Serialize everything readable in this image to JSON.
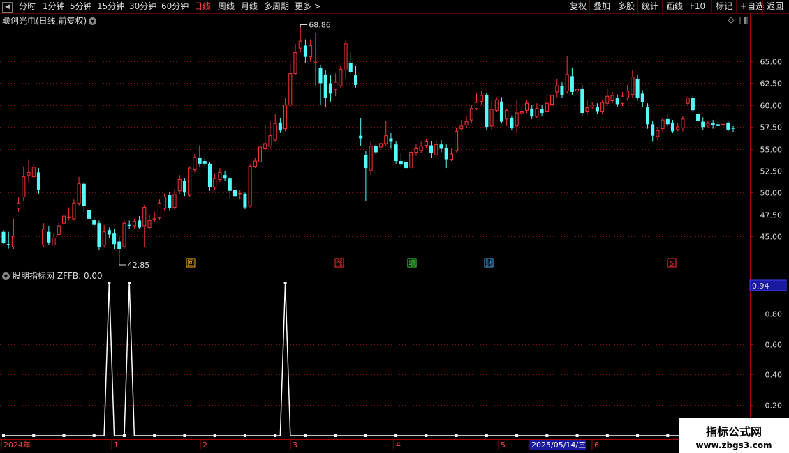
{
  "toolbar": {
    "periods": [
      "分时",
      "1分钟",
      "5分钟",
      "15分钟",
      "30分钟",
      "60分钟",
      "日线",
      "周线",
      "月线",
      "多周期",
      "更多 >"
    ],
    "active_period": "日线",
    "right_buttons": [
      "复权",
      "叠加",
      "多股",
      "统计",
      "画线",
      "F10",
      "标记",
      "+自选",
      "返回"
    ]
  },
  "main_panel": {
    "title": "联创光电(日线,前复权)",
    "high_label": "68.86",
    "low_label": "42.85",
    "price_ticks": [
      "65.00",
      "62.50",
      "60.00",
      "57.50",
      "55.00",
      "52.50",
      "50.00",
      "47.50",
      "45.00"
    ],
    "markers": [
      {
        "text": "回",
        "color": "#ffb020"
      },
      {
        "text": "涨",
        "color": "#ff3030"
      },
      {
        "text": "增",
        "color": "#40e040"
      },
      {
        "text": "财",
        "color": "#4ab0ff"
      },
      {
        "text": "$",
        "color": "#ff3030"
      }
    ]
  },
  "sub_panel": {
    "title": "股朋指标网",
    "indicator": "ZFFB: 0.00",
    "current_value": "0.94",
    "ticks": [
      "0.80",
      "0.60",
      "0.40",
      "0.20"
    ]
  },
  "date_axis": {
    "labels": [
      "2024年",
      "1",
      "2",
      "3",
      "4",
      "5",
      "2025/05/14/三",
      "6"
    ]
  },
  "watermark": {
    "title": "指标公式网",
    "url": "www.zbgs3.com"
  },
  "chart_data": {
    "type": "candlestick",
    "price_range": [
      42.0,
      70.0
    ],
    "sub_range": [
      0,
      1.0
    ],
    "high": 68.86,
    "low": 42.85,
    "sub_spikes": [
      {
        "candle_index": 21,
        "value": 1.0
      },
      {
        "candle_index": 25,
        "value": 1.0
      },
      {
        "candle_index": 56,
        "value": 1.0
      }
    ],
    "candles": [
      [
        45.5,
        44.2,
        45.7,
        44.1
      ],
      [
        44.1,
        44.0,
        45.5,
        43.6
      ],
      [
        43.8,
        45.0,
        47.0,
        43.5
      ],
      [
        48.2,
        48.8,
        49.5,
        47.8
      ],
      [
        49.5,
        51.8,
        53.0,
        49.0
      ],
      [
        52.0,
        52.3,
        53.8,
        51.2
      ],
      [
        51.8,
        52.9,
        53.3,
        51.5
      ],
      [
        52.3,
        50.3,
        52.8,
        49.8
      ],
      [
        44.0,
        45.8,
        46.5,
        43.7
      ],
      [
        45.5,
        44.3,
        46.2,
        44.0
      ],
      [
        44.0,
        44.8,
        45.3,
        43.9
      ],
      [
        45.2,
        46.2,
        46.6,
        45.0
      ],
      [
        46.5,
        47.3,
        48.0,
        45.9
      ],
      [
        47.2,
        47.2,
        48.3,
        46.8
      ],
      [
        47.0,
        48.8,
        49.2,
        46.8
      ],
      [
        48.8,
        51.0,
        51.8,
        48.5
      ],
      [
        51.0,
        48.5,
        51.2,
        47.8
      ],
      [
        48.0,
        47.0,
        49.0,
        46.5
      ],
      [
        46.9,
        46.3,
        47.1,
        46.0
      ],
      [
        46.5,
        43.8,
        46.8,
        43.4
      ],
      [
        44.0,
        45.5,
        46.3,
        43.7
      ],
      [
        45.7,
        45.2,
        46.0,
        44.8
      ],
      [
        45.3,
        44.1,
        45.8,
        43.5
      ],
      [
        44.4,
        43.5,
        45.0,
        42.85
      ],
      [
        43.8,
        46.5,
        46.8,
        43.6
      ],
      [
        46.3,
        46.2,
        46.8,
        45.8
      ],
      [
        46.2,
        46.7,
        47.0,
        45.9
      ],
      [
        46.8,
        46.0,
        47.3,
        45.8
      ],
      [
        46.2,
        48.3,
        48.6,
        43.8
      ],
      [
        46.0,
        46.8,
        47.5,
        45.8
      ],
      [
        46.9,
        47.0,
        47.8,
        46.6
      ],
      [
        47.1,
        48.8,
        49.2,
        46.9
      ],
      [
        48.2,
        49.5,
        49.9,
        47.9
      ],
      [
        49.7,
        48.2,
        50.1,
        47.9
      ],
      [
        48.3,
        49.8,
        50.4,
        48.0
      ],
      [
        50.2,
        51.5,
        52.0,
        49.8
      ],
      [
        51.3,
        50.0,
        51.6,
        49.6
      ],
      [
        49.7,
        52.8,
        53.0,
        49.5
      ],
      [
        52.6,
        54.0,
        54.4,
        52.3
      ],
      [
        54.0,
        53.3,
        55.4,
        52.9
      ],
      [
        53.6,
        53.3,
        54.0,
        53.0
      ],
      [
        53.3,
        50.6,
        53.5,
        50.2
      ],
      [
        50.6,
        51.6,
        52.2,
        50.3
      ],
      [
        51.5,
        52.3,
        52.8,
        51.2
      ],
      [
        52.0,
        51.6,
        52.5,
        51.3
      ],
      [
        51.6,
        50.2,
        51.8,
        49.3
      ],
      [
        50.3,
        49.6,
        50.6,
        49.3
      ],
      [
        49.8,
        49.9,
        50.3,
        49.2
      ],
      [
        49.8,
        48.3,
        50.0,
        48.1
      ],
      [
        48.5,
        53.0,
        53.2,
        48.3
      ],
      [
        53.0,
        53.6,
        54.0,
        52.8
      ],
      [
        53.5,
        55.2,
        55.8,
        53.2
      ],
      [
        55.0,
        55.6,
        57.8,
        54.8
      ],
      [
        55.3,
        56.5,
        58.2,
        55.0
      ],
      [
        56.0,
        57.9,
        59.0,
        55.8
      ],
      [
        58.0,
        57.1,
        58.5,
        56.8
      ],
      [
        57.3,
        60.0,
        60.8,
        57.0
      ],
      [
        60.0,
        63.6,
        64.7,
        59.8
      ],
      [
        63.6,
        66.0,
        67.0,
        63.4
      ],
      [
        66.5,
        67.3,
        68.86,
        66.0
      ],
      [
        66.8,
        65.5,
        67.5,
        64.8
      ],
      [
        65.5,
        66.8,
        67.5,
        65.0
      ],
      [
        64.8,
        64.9,
        68.3,
        62.2
      ],
      [
        64.2,
        62.5,
        64.6,
        60.0
      ],
      [
        63.5,
        60.8,
        64.0,
        59.8
      ],
      [
        62.5,
        61.3,
        63.4,
        60.4
      ],
      [
        61.8,
        62.6,
        63.6,
        61.0
      ],
      [
        62.2,
        64.1,
        64.5,
        62.0
      ],
      [
        64.0,
        67.0,
        67.5,
        63.0
      ],
      [
        64.8,
        63.8,
        66.0,
        63.5
      ],
      [
        63.4,
        62.3,
        64.5,
        62.0
      ],
      [
        56.5,
        56.2,
        58.5,
        55.3
      ],
      [
        54.3,
        52.8,
        54.8,
        49.0
      ],
      [
        52.5,
        55.3,
        55.8,
        52.0
      ],
      [
        55.3,
        54.6,
        55.6,
        54.3
      ],
      [
        55.2,
        55.6,
        57.0,
        54.8
      ],
      [
        55.6,
        56.5,
        58.2,
        55.3
      ],
      [
        56.2,
        55.8,
        56.8,
        55.0
      ],
      [
        55.5,
        53.6,
        55.9,
        53.3
      ],
      [
        53.6,
        53.2,
        54.5,
        53.0
      ],
      [
        53.5,
        52.8,
        54.0,
        52.6
      ],
      [
        52.9,
        54.6,
        55.0,
        52.7
      ],
      [
        54.6,
        55.0,
        55.5,
        54.2
      ],
      [
        54.8,
        55.3,
        55.8,
        54.5
      ],
      [
        55.4,
        55.8,
        56.1,
        55.1
      ],
      [
        55.4,
        54.5,
        55.9,
        54.0
      ],
      [
        54.3,
        55.5,
        56.0,
        54.0
      ],
      [
        55.5,
        55.0,
        56.0,
        54.6
      ],
      [
        55.1,
        53.8,
        55.5,
        52.8
      ],
      [
        53.8,
        54.4,
        55.0,
        53.6
      ],
      [
        54.8,
        57.0,
        57.4,
        54.6
      ],
      [
        57.3,
        57.6,
        58.3,
        57.1
      ],
      [
        57.7,
        58.1,
        58.7,
        57.4
      ],
      [
        58.3,
        59.6,
        60.0,
        57.9
      ],
      [
        59.6,
        60.3,
        61.3,
        59.4
      ],
      [
        60.4,
        61.1,
        61.6,
        60.0
      ],
      [
        61.1,
        57.5,
        61.4,
        57.2
      ],
      [
        57.6,
        59.5,
        60.5,
        57.2
      ],
      [
        59.4,
        60.6,
        60.9,
        59.2
      ],
      [
        60.4,
        58.1,
        60.9,
        57.9
      ],
      [
        58.4,
        59.4,
        59.6,
        57.6
      ],
      [
        58.5,
        57.4,
        58.8,
        57.1
      ],
      [
        57.6,
        59.1,
        60.6,
        56.8
      ],
      [
        59.1,
        59.3,
        59.8,
        58.8
      ],
      [
        59.4,
        60.2,
        60.6,
        59.1
      ],
      [
        59.6,
        58.7,
        60.0,
        58.4
      ],
      [
        58.7,
        59.6,
        60.2,
        58.5
      ],
      [
        59.5,
        59.1,
        60.0,
        58.7
      ],
      [
        59.3,
        60.2,
        61.1,
        59.0
      ],
      [
        60.1,
        61.1,
        61.7,
        59.8
      ],
      [
        61.5,
        62.2,
        63.0,
        60.9
      ],
      [
        62.2,
        61.1,
        62.6,
        60.8
      ],
      [
        61.6,
        63.5,
        65.6,
        61.3
      ],
      [
        63.3,
        61.5,
        64.3,
        61.1
      ],
      [
        61.6,
        61.8,
        62.3,
        61.3
      ],
      [
        61.9,
        59.1,
        62.3,
        58.8
      ],
      [
        59.3,
        59.7,
        60.6,
        58.9
      ],
      [
        59.8,
        60.0,
        60.3,
        59.5
      ],
      [
        59.8,
        59.3,
        60.2,
        59.0
      ],
      [
        59.3,
        60.3,
        60.6,
        59.0
      ],
      [
        60.2,
        61.0,
        61.9,
        59.9
      ],
      [
        60.5,
        61.1,
        61.5,
        60.2
      ],
      [
        60.8,
        60.1,
        61.2,
        59.8
      ],
      [
        60.2,
        61.0,
        61.5,
        59.9
      ],
      [
        60.8,
        61.6,
        62.3,
        60.5
      ],
      [
        61.2,
        63.2,
        64.0,
        60.8
      ],
      [
        63.0,
        60.8,
        63.5,
        60.5
      ],
      [
        61.3,
        60.3,
        61.7,
        59.8
      ],
      [
        59.8,
        57.8,
        60.2,
        57.3
      ],
      [
        57.8,
        56.5,
        58.2,
        55.8
      ],
      [
        56.4,
        57.1,
        57.5,
        56.0
      ],
      [
        57.3,
        58.3,
        58.6,
        56.9
      ],
      [
        58.4,
        57.8,
        58.9,
        57.5
      ],
      [
        58.0,
        57.0,
        58.3,
        56.8
      ],
      [
        57.2,
        57.5,
        58.0,
        57.0
      ],
      [
        57.4,
        58.4,
        58.7,
        57.0
      ],
      [
        60.2,
        60.8,
        61.0,
        60.0
      ],
      [
        60.8,
        59.4,
        61.1,
        59.1
      ],
      [
        59.0,
        58.2,
        59.4,
        57.9
      ],
      [
        58.1,
        57.5,
        58.6,
        57.2
      ],
      [
        57.7,
        57.9,
        58.2,
        57.4
      ],
      [
        57.9,
        57.7,
        58.3,
        57.3
      ],
      [
        57.8,
        57.6,
        58.4,
        57.5
      ],
      [
        57.7,
        57.8,
        58.5,
        57.5
      ],
      [
        58.0,
        57.2,
        58.2,
        57.0
      ],
      [
        57.4,
        57.3,
        57.6,
        56.9
      ]
    ]
  }
}
